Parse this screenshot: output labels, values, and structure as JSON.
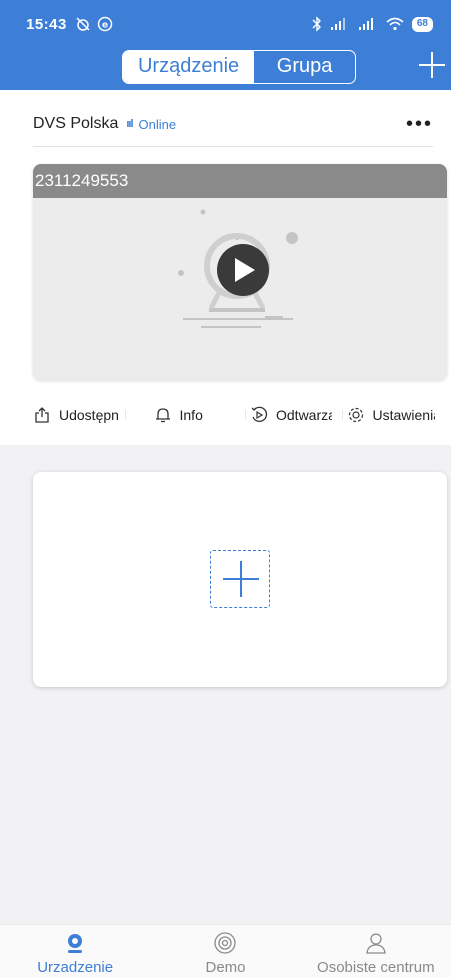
{
  "status_bar": {
    "time": "15:43",
    "battery": "68"
  },
  "header": {
    "segments": [
      {
        "label": "Urządzenie",
        "active": true
      },
      {
        "label": "Grupa",
        "active": false
      }
    ],
    "add_icon": "plus-icon"
  },
  "device": {
    "name": "DVS Polska",
    "signal": "ııl",
    "status": "Online",
    "more": "•••",
    "camera_id": "2311249553"
  },
  "actions": [
    {
      "label": "Udostępnij",
      "icon": "share-icon"
    },
    {
      "label": "Info",
      "icon": "bell-icon"
    },
    {
      "label": "Odtwarzanie",
      "icon": "playback-icon"
    },
    {
      "label": "Ustawienia",
      "icon": "settings-icon"
    }
  ],
  "tabs": [
    {
      "label": "Urzadzenie",
      "icon": "camera-icon",
      "active": true
    },
    {
      "label": "Demo",
      "icon": "demo-icon",
      "active": false
    },
    {
      "label": "Osobiste centrum",
      "icon": "person-icon",
      "active": false
    }
  ],
  "colors": {
    "accent": "#3d7fd6",
    "header_bg": "#3d7fd6",
    "id_bar": "#8a8a8a"
  }
}
